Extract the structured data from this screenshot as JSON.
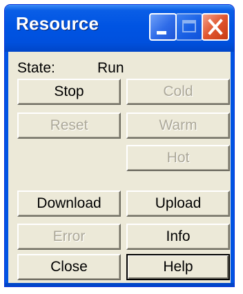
{
  "window": {
    "title": "Resource"
  },
  "state": {
    "label": "State:",
    "value": "Run"
  },
  "buttons": {
    "stop": "Stop",
    "cold": "Cold",
    "reset": "Reset",
    "warm": "Warm",
    "hot": "Hot",
    "download": "Download",
    "upload": "Upload",
    "error": "Error",
    "info": "Info",
    "close": "Close",
    "help": "Help"
  },
  "colors": {
    "titlebar": "#0054e3",
    "face": "#ece9d8",
    "close_button": "#e0552e",
    "disabled_text": "#aca899"
  },
  "icons": {
    "minimize": "minimize-icon",
    "maximize": "maximize-icon",
    "close": "close-icon"
  }
}
